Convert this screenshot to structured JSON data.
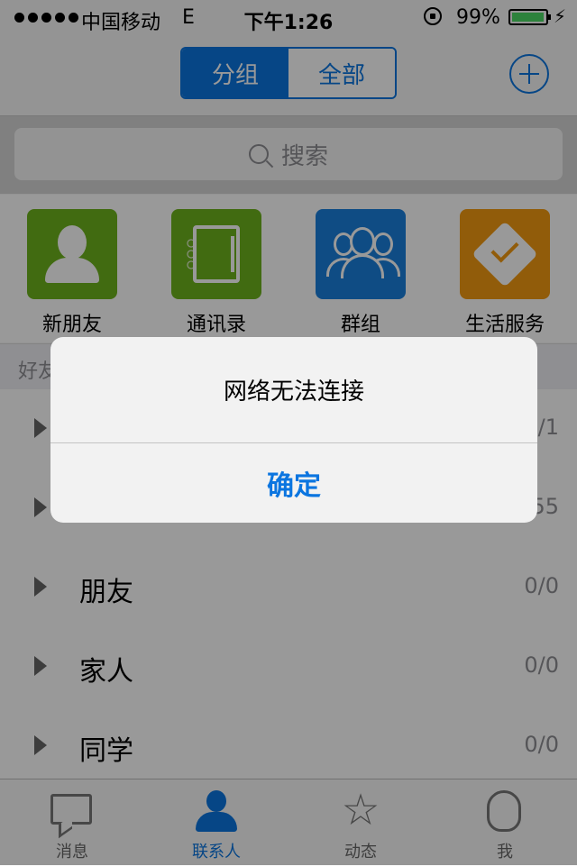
{
  "status": {
    "carrier": "中国移动",
    "network": "E",
    "time": "下午1:26",
    "battery": "99%"
  },
  "nav": {
    "tabs": [
      {
        "label": "分组",
        "active": true
      },
      {
        "label": "全部",
        "active": false
      }
    ]
  },
  "search": {
    "placeholder": "搜索"
  },
  "quick": [
    {
      "label": "新朋友",
      "icon": "person-icon",
      "color": "#6db31d"
    },
    {
      "label": "通讯录",
      "icon": "address-book-icon",
      "color": "#6db31d"
    },
    {
      "label": "群组",
      "icon": "group-icon",
      "color": "#1a7fdc"
    },
    {
      "label": "生活服务",
      "icon": "service-badge-icon",
      "color": "#f29a12"
    }
  ],
  "groups": {
    "header": "好友",
    "rows": [
      {
        "name": "",
        "count": "0/1"
      },
      {
        "name": "",
        "count": "55"
      },
      {
        "name": "朋友",
        "count": "0/0"
      },
      {
        "name": "家人",
        "count": "0/0"
      },
      {
        "name": "同学",
        "count": "0/0"
      }
    ]
  },
  "tabbar": [
    {
      "label": "消息",
      "icon": "chat-icon",
      "active": false
    },
    {
      "label": "联系人",
      "icon": "contacts-icon",
      "active": true
    },
    {
      "label": "动态",
      "icon": "star-icon",
      "active": false
    },
    {
      "label": "我",
      "icon": "penguin-icon",
      "active": false
    }
  ],
  "alert": {
    "message": "网络无法连接",
    "confirm": "确定"
  }
}
